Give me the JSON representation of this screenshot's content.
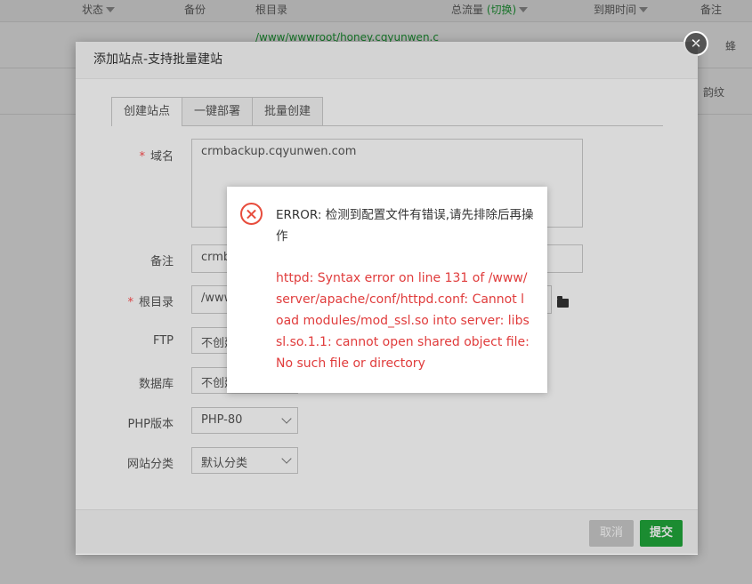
{
  "table": {
    "headers": [
      "状态",
      "备份",
      "根目录",
      "总流量",
      "(切换)",
      "到期时间",
      "备注"
    ],
    "rows": [
      {
        "path": "/www/wwwroot/honey.cqyunwen.c",
        "remark": "蜂"
      },
      {
        "path": "",
        "remark": "韵纹"
      }
    ]
  },
  "modal": {
    "title": "添加站点-支持批量建站",
    "tabs": [
      "创建站点",
      "一键部署",
      "批量创建"
    ],
    "domain_label": "域名",
    "domain_value": "crmbackup.cqyunwen.com",
    "remark_label": "备注",
    "remark_value": "crmb",
    "root_label": "根目录",
    "root_value": "/www",
    "ftp_label": "FTP",
    "ftp_value": "不创建",
    "db_label": "数据库",
    "db_value": "不创建",
    "php_label": "PHP版本",
    "php_value": "PHP-80",
    "category_label": "网站分类",
    "category_value": "默认分类",
    "cancel_label": "取消",
    "submit_label": "提交"
  },
  "error": {
    "title": "ERROR: 检测到配置文件有错误,请先排除后再操作",
    "detail": "httpd: Syntax error on line 131 of /www/server/apache/conf/httpd.conf: Cannot load modules/mod_ssl.so into server: libssl.so.1.1: cannot open shared object file: No such file or directory"
  },
  "colors": {
    "accent": "#20a53a",
    "error": "#e03c3c"
  }
}
